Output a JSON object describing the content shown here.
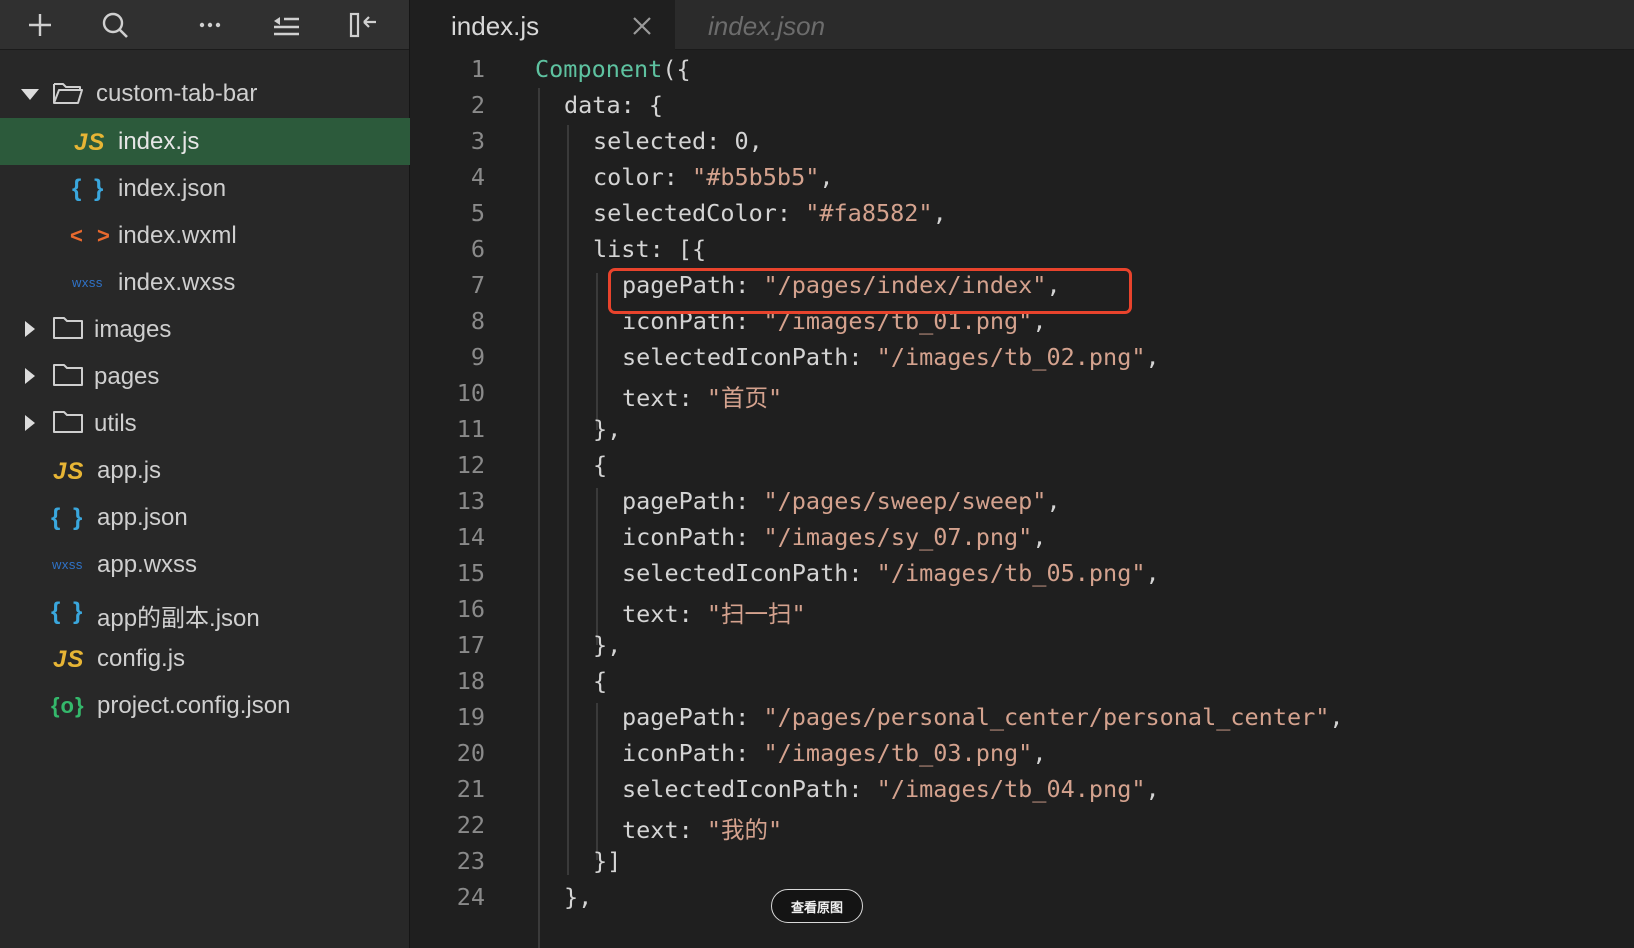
{
  "toolbar": {
    "add_icon": "plus-icon",
    "search_icon": "search-icon",
    "more_icon": "more-icon",
    "outline_icon": "outline-icon",
    "collapse_icon": "collapse-sidebar-icon"
  },
  "tree": {
    "root_folder": "custom-tab-bar",
    "root_files": [
      {
        "label": "index.js",
        "icon_text": "JS"
      },
      {
        "label": "index.json",
        "icon_text": "{ }"
      },
      {
        "label": "index.wxml",
        "icon_text": "< >"
      },
      {
        "label": "index.wxss",
        "icon_text": "wxss"
      }
    ],
    "folders": [
      "images",
      "pages",
      "utils"
    ],
    "files": [
      {
        "label": "app.js",
        "icon_text": "JS"
      },
      {
        "label": "app.json",
        "icon_text": "{ }"
      },
      {
        "label": "app.wxss",
        "icon_text": "wxss"
      },
      {
        "label": "app的副本.json",
        "icon_text": "{ }"
      },
      {
        "label": "config.js",
        "icon_text": "JS"
      },
      {
        "label": "project.config.json",
        "icon_text": "{o}"
      }
    ]
  },
  "tabs": [
    {
      "label": "index.js",
      "active": true
    },
    {
      "label": "index.json",
      "active": false
    }
  ],
  "editor": {
    "lines": [
      {
        "n": "1"
      },
      {
        "n": "2"
      },
      {
        "n": "3"
      },
      {
        "n": "4"
      },
      {
        "n": "5"
      },
      {
        "n": "6"
      },
      {
        "n": "7"
      },
      {
        "n": "8"
      },
      {
        "n": "9"
      },
      {
        "n": "10"
      },
      {
        "n": "11"
      },
      {
        "n": "12"
      },
      {
        "n": "13"
      },
      {
        "n": "14"
      },
      {
        "n": "15"
      },
      {
        "n": "16"
      },
      {
        "n": "17"
      },
      {
        "n": "18"
      },
      {
        "n": "19"
      },
      {
        "n": "20"
      },
      {
        "n": "21"
      },
      {
        "n": "22"
      },
      {
        "n": "23"
      },
      {
        "n": "24"
      }
    ],
    "code": {
      "l1_fn": "Component",
      "l1_rest": "({",
      "l2": "data: {",
      "l3": "selected: 0,",
      "l4_key": "color: ",
      "l4_val": "\"#b5b5b5\"",
      "l4_end": ",",
      "l5_key": "selectedColor: ",
      "l5_val": "\"#fa8582\"",
      "l5_end": ",",
      "l6": "list: [{",
      "l7_key": "pagePath: ",
      "l7_val": "\"/pages/index/index\"",
      "l7_end": ",",
      "l8_key": "iconPath: ",
      "l8_val": "\"/images/tb_01.png\"",
      "l8_end": ",",
      "l9_key": "selectedIconPath: ",
      "l9_val": "\"/images/tb_02.png\"",
      "l9_end": ",",
      "l10_key": "text: ",
      "l10_val": "\"首页\"",
      "l11": "},",
      "l12": "{",
      "l13_key": "pagePath: ",
      "l13_val": "\"/pages/sweep/sweep\"",
      "l13_end": ",",
      "l14_key": "iconPath: ",
      "l14_val": "\"/images/sy_07.png\"",
      "l14_end": ",",
      "l15_key": "selectedIconPath: ",
      "l15_val": "\"/images/tb_05.png\"",
      "l15_end": ",",
      "l16_key": "text: ",
      "l16_val": "\"扫一扫\"",
      "l17": "},",
      "l18": "{",
      "l19_key": "pagePath: ",
      "l19_val": "\"/pages/personal_center/personal_center\"",
      "l19_end": ",",
      "l20_key": "iconPath: ",
      "l20_val": "\"/images/tb_03.png\"",
      "l20_end": ",",
      "l21_key": "selectedIconPath: ",
      "l21_val": "\"/images/tb_04.png\"",
      "l21_end": ",",
      "l22_key": "text: ",
      "l22_val": "\"我的\"",
      "l23": "}]",
      "l24": "},"
    }
  },
  "overlay": {
    "view_original_label": "查看原图"
  },
  "colors": {
    "selected_row": "#2c5a3b",
    "highlight_border": "#e8432c",
    "string": "#d4a28e",
    "function": "#5ec2a0"
  }
}
